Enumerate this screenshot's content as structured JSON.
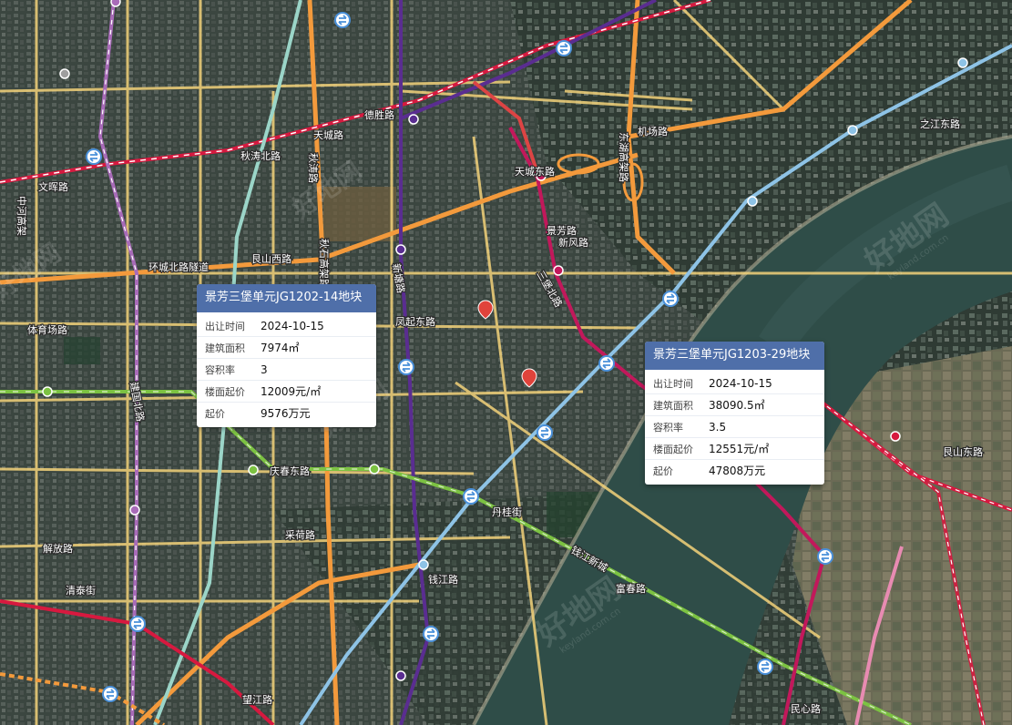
{
  "colors": {
    "card_header": "#4f6fa9",
    "metro_red": "#d7193f",
    "metro_purple": "#5a2d91",
    "metro_lightblue": "#8ec3e6",
    "metro_green": "#7cc242",
    "metro_magenta": "#c2185b",
    "metro_violet": "#a86bb8",
    "metro_mint": "#9bd5c8",
    "road_orange": "#f39a3c",
    "road_yellow": "#f3d27a",
    "river": "#2e4a44"
  },
  "road_labels": [
    "天城路",
    "秋石高架路",
    "艮山西路",
    "环城北路隧道",
    "秋涛路",
    "新塘路",
    "景芳路",
    "凤起东路",
    "庆春东路",
    "采荷路",
    "解放路",
    "钱江路",
    "之江东路",
    "文晖路",
    "德胜路",
    "中河高架",
    "体育场路",
    "建国北路",
    "清泰街",
    "望江路",
    "民心路",
    "富春路",
    "三堡北路",
    "东湖高架路",
    "新风路",
    "天城东路",
    "机场路",
    "艮山东路",
    "钱江新城",
    "秋涛北路",
    "丹桂街"
  ],
  "watermark": {
    "brand": "好地网",
    "url": "keyland.com.cn"
  },
  "parcels": [
    {
      "title": "景芳三堡单元JG1202-14地块",
      "rows": [
        {
          "label": "出让时间",
          "value": "2024-10-15"
        },
        {
          "label": "建筑面积",
          "value": "7974㎡"
        },
        {
          "label": "容积率",
          "value": "3"
        },
        {
          "label": "楼面起价",
          "value": "12009元/㎡"
        },
        {
          "label": "起价",
          "value": "9576万元"
        }
      ]
    },
    {
      "title": "景芳三堡单元JG1203-29地块",
      "rows": [
        {
          "label": "出让时间",
          "value": "2024-10-15"
        },
        {
          "label": "建筑面积",
          "value": "38090.5㎡"
        },
        {
          "label": "容积率",
          "value": "3.5"
        },
        {
          "label": "楼面起价",
          "value": "12551元/㎡"
        },
        {
          "label": "起价",
          "value": "47808万元"
        }
      ]
    }
  ]
}
